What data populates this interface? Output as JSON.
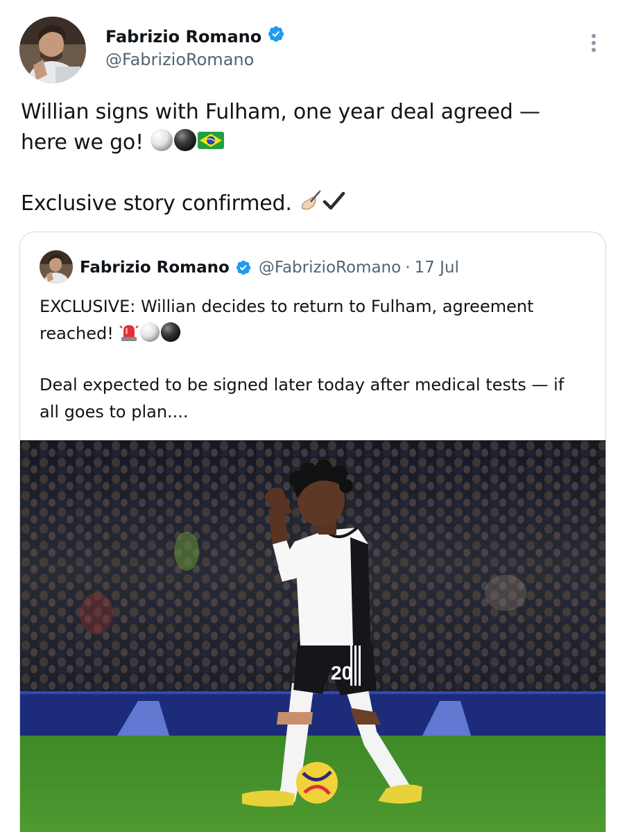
{
  "author": {
    "name": "Fabrizio Romano",
    "handle": "@FabrizioRomano",
    "verified": true
  },
  "tweet": {
    "line1": "Willian signs with Fulham, one year deal agreed —",
    "line2": "here we go!",
    "line2_emojis": [
      "white-ball-emoji",
      "black-ball-emoji",
      "brazil-flag-emoji"
    ],
    "paragraph2": "Exclusive story confirmed.",
    "paragraph2_emojis": [
      "writing-hand-emoji",
      "check-mark-emoji"
    ]
  },
  "quoted_tweet": {
    "name": "Fabrizio Romano",
    "handle": "@FabrizioRomano",
    "separator": "·",
    "date": "17 Jul",
    "line1": "EXCLUSIVE: Willian decides to return to Fulham, agreement",
    "line2": "reached!",
    "line2_emojis": [
      "rotating-light-emoji",
      "white-ball-emoji",
      "black-ball-emoji"
    ],
    "paragraph2_line1": "Deal expected to be signed later today after medical tests — if",
    "paragraph2_line2": "all goes to plan....",
    "media": {
      "icon": "football-player-photo",
      "shirt_number": "20"
    }
  },
  "colors": {
    "text_primary": "#0f1419",
    "text_secondary": "#536471",
    "verified_blue": "#1d9bf0",
    "card_border": "#cfd9de",
    "pitch_green": "#3f8f2a"
  }
}
